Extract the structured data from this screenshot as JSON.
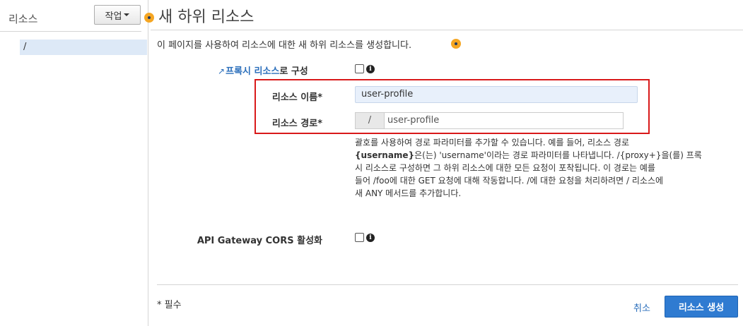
{
  "sidebar": {
    "title": "리소스",
    "actions_label": "작업",
    "tree": [
      "/"
    ]
  },
  "main": {
    "title": "새 하위 리소스",
    "intro": "이 페이지를 사용하여 리소스에 대한 새 하위 리소스를 생성합니다.",
    "proxy_link": "프록시 리소스",
    "proxy_suffix": "로 구성",
    "resource_name_label": "리소스 이름*",
    "resource_name_value": "user-profile",
    "resource_path_label": "리소스 경로*",
    "resource_path_prefix": "/",
    "resource_path_value": "user-profile",
    "help_line1": "괄호를 사용하여 경로 파라미터를 추가할 수 있습니다. 예를 들어, 리소스 경로",
    "help_bold": "{username}",
    "help_line2": "은(는) 'username'이라는 경로 파라미터를 나타냅니다. /{proxy+}을(를) 프록",
    "help_line3": "시 리소스로 구성하면 그 하위 리소스에 대한 모든 요청이 포착됩니다. 이 경로는 예를",
    "help_line4": "들어 /foo에 대한 GET 요청에 대해 작동합니다. /에 대한 요청을 처리하려면 / 리소스에",
    "help_line5": "새 ANY 메서드를 추가합니다.",
    "cors_label": "API Gateway CORS 활성화",
    "required_note": "* 필수",
    "cancel_label": "취소",
    "create_label": "리소스 생성"
  },
  "icons": {
    "info": "info-icon",
    "external_link": "external-link-icon",
    "help_dot": "help-dot-icon"
  },
  "colors": {
    "accent": "#2f7bd1",
    "link": "#2a6ebb",
    "highlight_box": "#d9191a",
    "help_dot": "#f5a623"
  }
}
